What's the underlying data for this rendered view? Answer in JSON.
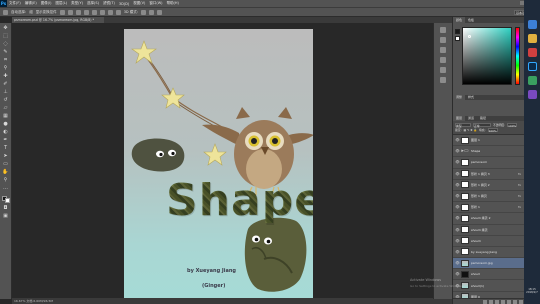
{
  "app": {
    "logo": "Ps",
    "menu": [
      "文件(F)",
      "编辑(E)",
      "图像(I)",
      "图层(L)",
      "类型(Y)",
      "选择(S)",
      "滤镜(T)",
      "3D(D)",
      "视图(V)",
      "窗口(W)",
      "帮助(H)"
    ],
    "options_bar": {
      "auto_select": "自动选择:",
      "auto_select_target": "组",
      "show_transform": "显示变换控件",
      "mode_3d": "3D 模式:",
      "workspace": "基本功能"
    },
    "doc_tab": "psmoreom.psd @ 16.7% (psmoreom.jpg, RGB/8) *",
    "status_text": "16.67%    文档:6.60M/96.5M"
  },
  "poster": {
    "title": "Shape",
    "credit_line1": "by Xueyang Jiang",
    "credit_line2": "(Ginger)"
  },
  "panels": {
    "color_tabs": [
      "颜色",
      "色板"
    ],
    "adjust_tabs": [
      "调整",
      "样式"
    ],
    "layers_tabs": [
      "图层",
      "通道",
      "路径"
    ],
    "layer_opts": {
      "kind": "类型",
      "blend": "正常",
      "opacity_label": "不透明度:",
      "opacity": "100%",
      "lock_label": "锁定:",
      "fill_label": "填充:",
      "fill": "100%"
    },
    "layers": [
      {
        "name": "图层 1",
        "thumb": "white",
        "fx": ""
      },
      {
        "name": "Shape",
        "thumb": "folder",
        "fx": ""
      },
      {
        "name": "psmoreom",
        "thumb": "white",
        "fx": ""
      },
      {
        "name": "形状 1 拷贝 3",
        "thumb": "white",
        "fx": "fx"
      },
      {
        "name": "形状 1 拷贝 2",
        "thumb": "white",
        "fx": "fx"
      },
      {
        "name": "形状 1 拷贝",
        "thumb": "white",
        "fx": "fx"
      },
      {
        "name": "形状 1",
        "thumb": "white",
        "fx": "fx"
      },
      {
        "name": "shoulli 拷贝 2",
        "thumb": "white",
        "fx": ""
      },
      {
        "name": "shoulli 拷贝",
        "thumb": "white",
        "fx": ""
      },
      {
        "name": "shoulli",
        "thumb": "white",
        "fx": ""
      },
      {
        "name": "by xueyang Jiang",
        "thumb": "white",
        "fx": ""
      },
      {
        "name": "psmoreom.jpg",
        "thumb": "grad",
        "fx": "",
        "selected": true
      },
      {
        "name": "shoull",
        "thumb": "dark",
        "fx": ""
      },
      {
        "name": "shoull(1)",
        "thumb": "grad",
        "fx": ""
      },
      {
        "name": "图层 0",
        "thumb": "grad",
        "fx": ""
      }
    ]
  },
  "overlay": {
    "activate_line1": "Activate Windows",
    "activate_line2": "Go to Settings to activate Windows.",
    "clock_time": "18:15",
    "clock_date": "2018/1/7"
  }
}
